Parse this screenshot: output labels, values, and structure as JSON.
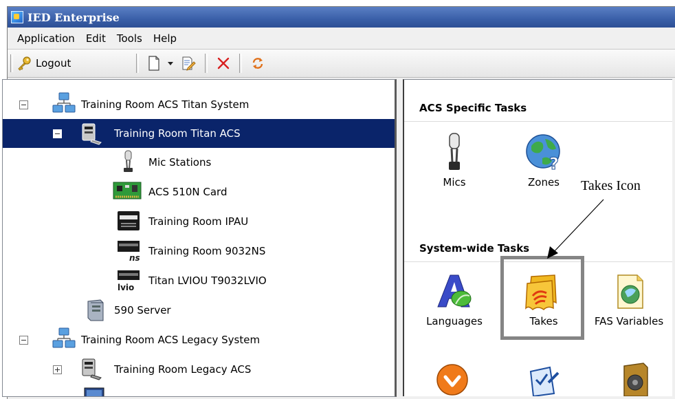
{
  "window": {
    "title": "IED Enterprise"
  },
  "menu": [
    "Application",
    "Edit",
    "Tools",
    "Help"
  ],
  "toolbar": {
    "logout_label": "Logout"
  },
  "tree": [
    {
      "label": "Training Room ACS Titan System",
      "expander": "minus",
      "icon": "network-icon"
    },
    {
      "label": "Training Room Titan ACS",
      "expander": "minus",
      "icon": "acs-device-icon",
      "selected": true
    },
    {
      "label": "Mic Stations",
      "icon": "mic-icon"
    },
    {
      "label": "ACS 510N Card",
      "icon": "card-icon"
    },
    {
      "label": "Training Room IPAU",
      "icon": "ipau-icon"
    },
    {
      "label": "Training Room 9032NS",
      "icon": "ns-device-icon"
    },
    {
      "label": "Titan LVIOU T9032LVIO",
      "icon": "lvio-device-icon"
    },
    {
      "label": "590 Server",
      "icon": "server-icon"
    },
    {
      "label": "Training Room ACS Legacy System",
      "expander": "minus",
      "icon": "network-icon"
    },
    {
      "label": "Training Room Legacy ACS",
      "expander": "plus",
      "icon": "acs-device-icon"
    }
  ],
  "tasks": {
    "acs_header": "ACS Specific Tasks",
    "acs": [
      {
        "label": "Mics",
        "icon": "mic-icon"
      },
      {
        "label": "Zones",
        "icon": "globe-icon"
      }
    ],
    "system_header": "System-wide Tasks",
    "system": [
      {
        "label": "Languages",
        "icon": "languages-icon"
      },
      {
        "label": "Takes",
        "icon": "takes-icon"
      },
      {
        "label": "FAS Variables",
        "icon": "fas-variables-icon"
      }
    ]
  },
  "annotation": {
    "text": "Takes Icon"
  }
}
